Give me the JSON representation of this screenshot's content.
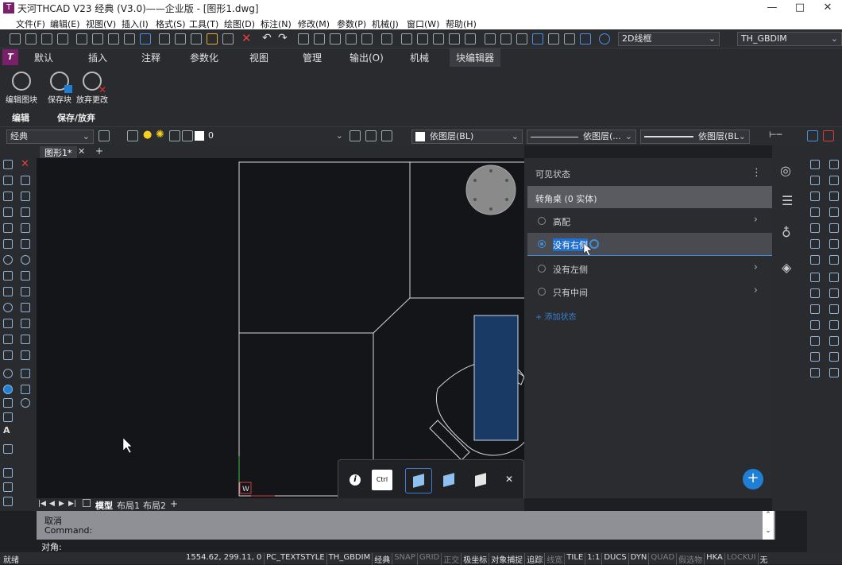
{
  "titlebar": {
    "app_title": "天河THCAD V23 经典 (V3.0)——企业版 - [图形1.dwg]",
    "logo": "T",
    "minimize": "—",
    "maximize": "□",
    "close": "✕"
  },
  "menubar": [
    "文件(F)",
    "编辑(E)",
    "视图(V)",
    "插入(I)",
    "格式(S)",
    "工具(T)",
    "绘图(D)",
    "标注(N)",
    "修改(M)",
    "参数(P)",
    "机械(J)",
    "窗口(W)",
    "帮助(H)"
  ],
  "toolbar1": {
    "visual_style": "2D线框",
    "dimstyle": "TH_GBDIM"
  },
  "ribbon_tabs": [
    "默认",
    "插入",
    "注释",
    "参数化",
    "视图",
    "管理",
    "输出(O)",
    "机械",
    "块编辑器"
  ],
  "ribbon_tab_logo": "T",
  "ribbon": {
    "buttons": [
      "编辑图块",
      "保存块",
      "放弃更改"
    ],
    "groups": [
      "编辑",
      "保存/放弃"
    ]
  },
  "props": {
    "workspace": "经典",
    "layer": "0",
    "color": "依图层(BL)",
    "linetype": "依图层(...",
    "lineweight": "依图层(BL"
  },
  "doc_tabs": {
    "active": "图形1*",
    "close": "✕",
    "add": "+"
  },
  "panel": {
    "header": "可见状态",
    "menu_icon": "⋮",
    "block_name": "转角桌 (0 实体)",
    "states": [
      {
        "label": "高配",
        "selected": false
      },
      {
        "label": "没有右侧",
        "selected": true
      },
      {
        "label": "没有左侧",
        "selected": false
      },
      {
        "label": "只有中间",
        "selected": false
      }
    ],
    "add_state": "+ 添加状态",
    "fab": "+"
  },
  "floatbar": {
    "ctrl_label": "Ctrl",
    "close": "✕"
  },
  "layout_tabs": [
    "模型",
    "布局1",
    "布局2"
  ],
  "layout_add": "+",
  "command": {
    "line1": "取消",
    "line2": "Command:",
    "prompt": "对角:"
  },
  "status": {
    "left": "就绪",
    "coords": "1554.62, 299.11, 0",
    "items": [
      {
        "t": "PC_TEXTSTYLE",
        "on": true
      },
      {
        "t": "TH_GBDIM",
        "on": true
      },
      {
        "t": "经典",
        "on": true
      },
      {
        "t": "SNAP",
        "on": false
      },
      {
        "t": "GRID",
        "on": false
      },
      {
        "t": "正交",
        "on": false
      },
      {
        "t": "极坐标",
        "on": true
      },
      {
        "t": "对象捕捉",
        "on": true
      },
      {
        "t": "追踪",
        "on": true
      },
      {
        "t": "线宽",
        "on": false
      },
      {
        "t": "TILE",
        "on": true
      },
      {
        "t": "1:1",
        "on": true
      },
      {
        "t": "DUCS",
        "on": true
      },
      {
        "t": "DYN",
        "on": true
      },
      {
        "t": "QUAD",
        "on": false
      },
      {
        "t": "假选物",
        "on": false
      },
      {
        "t": "HKA",
        "on": true
      },
      {
        "t": "LOCKUI",
        "on": false
      },
      {
        "t": "无",
        "on": true
      }
    ]
  },
  "colors": {
    "accent": "#1f7fd6",
    "selected_fill": "#1a3a66"
  }
}
